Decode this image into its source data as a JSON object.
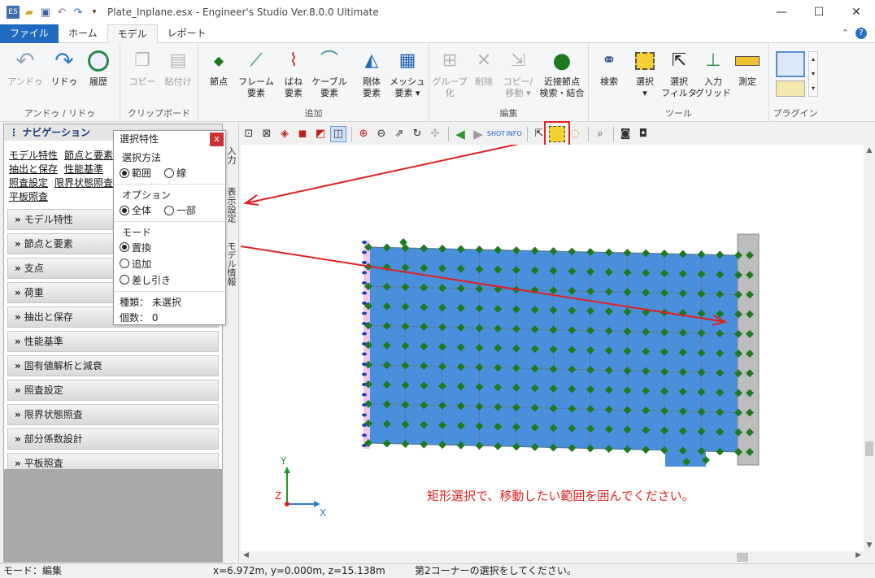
{
  "window": {
    "title": "Plate_Inplane.esx - Engineer's Studio Ver.8.0.0 Ultimate",
    "minimize": "—",
    "maximize": "☐",
    "close": "✕"
  },
  "tabs": [
    {
      "label": "ファイル"
    },
    {
      "label": "ホーム"
    },
    {
      "label": "モデル"
    },
    {
      "label": "レポート"
    }
  ],
  "tab_right": {
    "collapse": "⌃",
    "help": "?"
  },
  "ribbon": {
    "groups": [
      {
        "label": "アンドゥ / リドゥ"
      },
      {
        "label": "クリップボード"
      },
      {
        "label": "追加"
      },
      {
        "label": "編集"
      },
      {
        "label": "ツール"
      },
      {
        "label": "プラグイン"
      }
    ],
    "buttons": {
      "undo": "アンドゥ",
      "redo": "リドゥ",
      "history": "履歴",
      "copy": "コピー",
      "paste": "貼付け",
      "node": "節点",
      "frame1": "フレーム",
      "frame2": "要素",
      "spring1": "ばね",
      "spring2": "要素",
      "cable1": "ケーブル",
      "cable2": "要素",
      "rigid1": "剛体",
      "rigid2": "要素",
      "mesh1": "メッシュ",
      "mesh2": "要素 ▾",
      "group1": "グループ",
      "group2": "化",
      "delete": "削除",
      "copymove1": "コピー/",
      "copymove2": "移動 ▾",
      "nearnode1": "近接節点",
      "nearnode2": "検索・結合",
      "search": "検索",
      "select1": "選択",
      "select2": "▾",
      "selfilter1": "選択",
      "selfilter2": "フィルタ",
      "inputgrid1": "入力",
      "inputgrid2": "グリッド",
      "measure": "測定"
    }
  },
  "navigation": {
    "title": "ナビゲーション",
    "links": [
      "モデル特性",
      "節点と要素",
      "抽出と保存",
      "性能基準",
      "照査設定",
      "限界状態照査",
      "平板照査"
    ],
    "sections": [
      "モデル特性",
      "節点と要素",
      "支点",
      "荷重",
      "抽出と保存",
      "性能基準",
      "固有値解析と減衰",
      "照査設定",
      "限界状態照査",
      "部分係数設計",
      "平板照査"
    ]
  },
  "side_strip": {
    "tab1": "入力",
    "tab2": "表示設定",
    "tab3": "モデル情報"
  },
  "selection_popup": {
    "title": "選択特性",
    "close": "x",
    "method_label": "選択方法",
    "method_range": "範囲",
    "method_line": "線",
    "option_label": "オプション",
    "option_all": "全体",
    "option_part": "一部",
    "mode_label": "モード",
    "mode_replace": "置換",
    "mode_add": "追加",
    "mode_subtract": "差し引き",
    "type_label": "種類：",
    "type_value": "未選択",
    "count_label": "個数：",
    "count_value": "0"
  },
  "viewport": {
    "instruction": "矩形選択で、移動したい範囲を囲んでください。",
    "axis_x": "X",
    "axis_y": "Y",
    "axis_z": "Z",
    "colors": {
      "plate": "#4a8fdc",
      "node": "#1f7a1f",
      "arrow": "#e02020",
      "instruction": "#e02020"
    }
  },
  "status": {
    "mode": "モード：編集",
    "coords": "x=6.972m, y=0.000m, z=15.138m",
    "message": "第2コーナーの選択をしてください。"
  }
}
